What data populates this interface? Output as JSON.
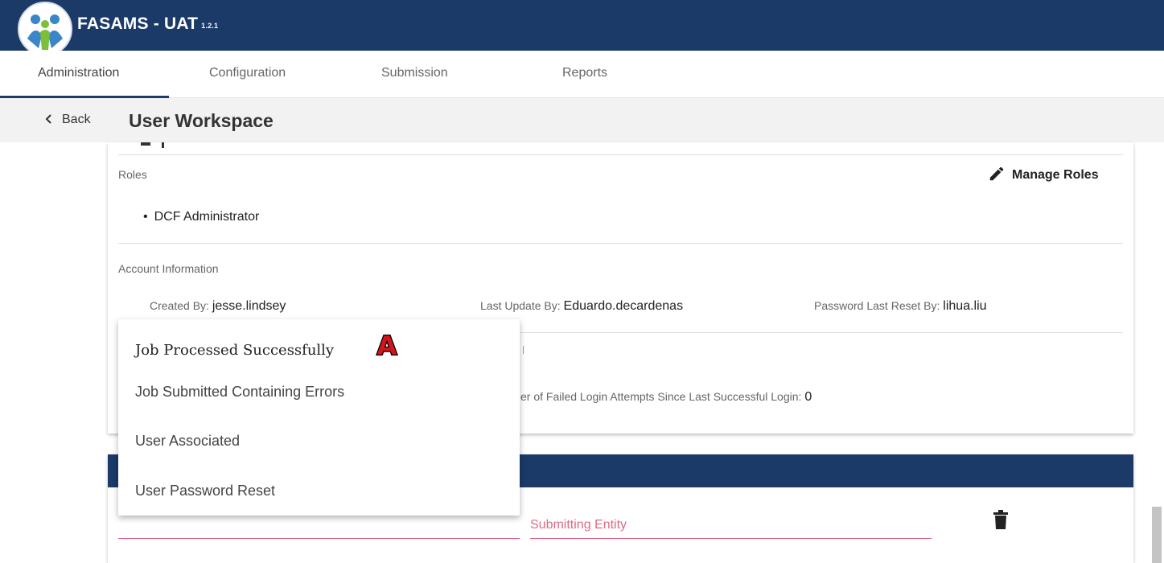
{
  "app": {
    "title": "FASAMS - UAT",
    "version": "1.2.1"
  },
  "tabs": [
    {
      "label": "Administration",
      "active": true
    },
    {
      "label": "Configuration"
    },
    {
      "label": "Submission"
    },
    {
      "label": "Reports"
    }
  ],
  "subheader": {
    "back_label": "Back",
    "title": "User Workspace"
  },
  "roles": {
    "label": "Roles",
    "manage_label": "Manage Roles",
    "items": [
      "DCF Administrator"
    ]
  },
  "account": {
    "label": "Account Information",
    "created_by_label": "Created By:",
    "created_by": "jesse.lindsey",
    "last_update_label": "Last Update By:",
    "last_update": "Eduardo.decardenas",
    "pw_reset_label": "Password Last Reset By:",
    "pw_reset": "lihua.liu",
    "failed_label_partial": "er of Failed Login Attempts Since Last Successful Login:",
    "failed_value": "0"
  },
  "dropdown": {
    "items": [
      "Job Processed Successfully",
      "Job Submitted Containing Errors",
      "User Associated",
      "User Password Reset"
    ],
    "marker": "A"
  },
  "section2": {
    "submitting_entity_placeholder": "Submitting Entity"
  },
  "colors": {
    "navy": "#1b3a68",
    "accent_pink": "#e0607e",
    "marker_red": "#d0161d"
  }
}
